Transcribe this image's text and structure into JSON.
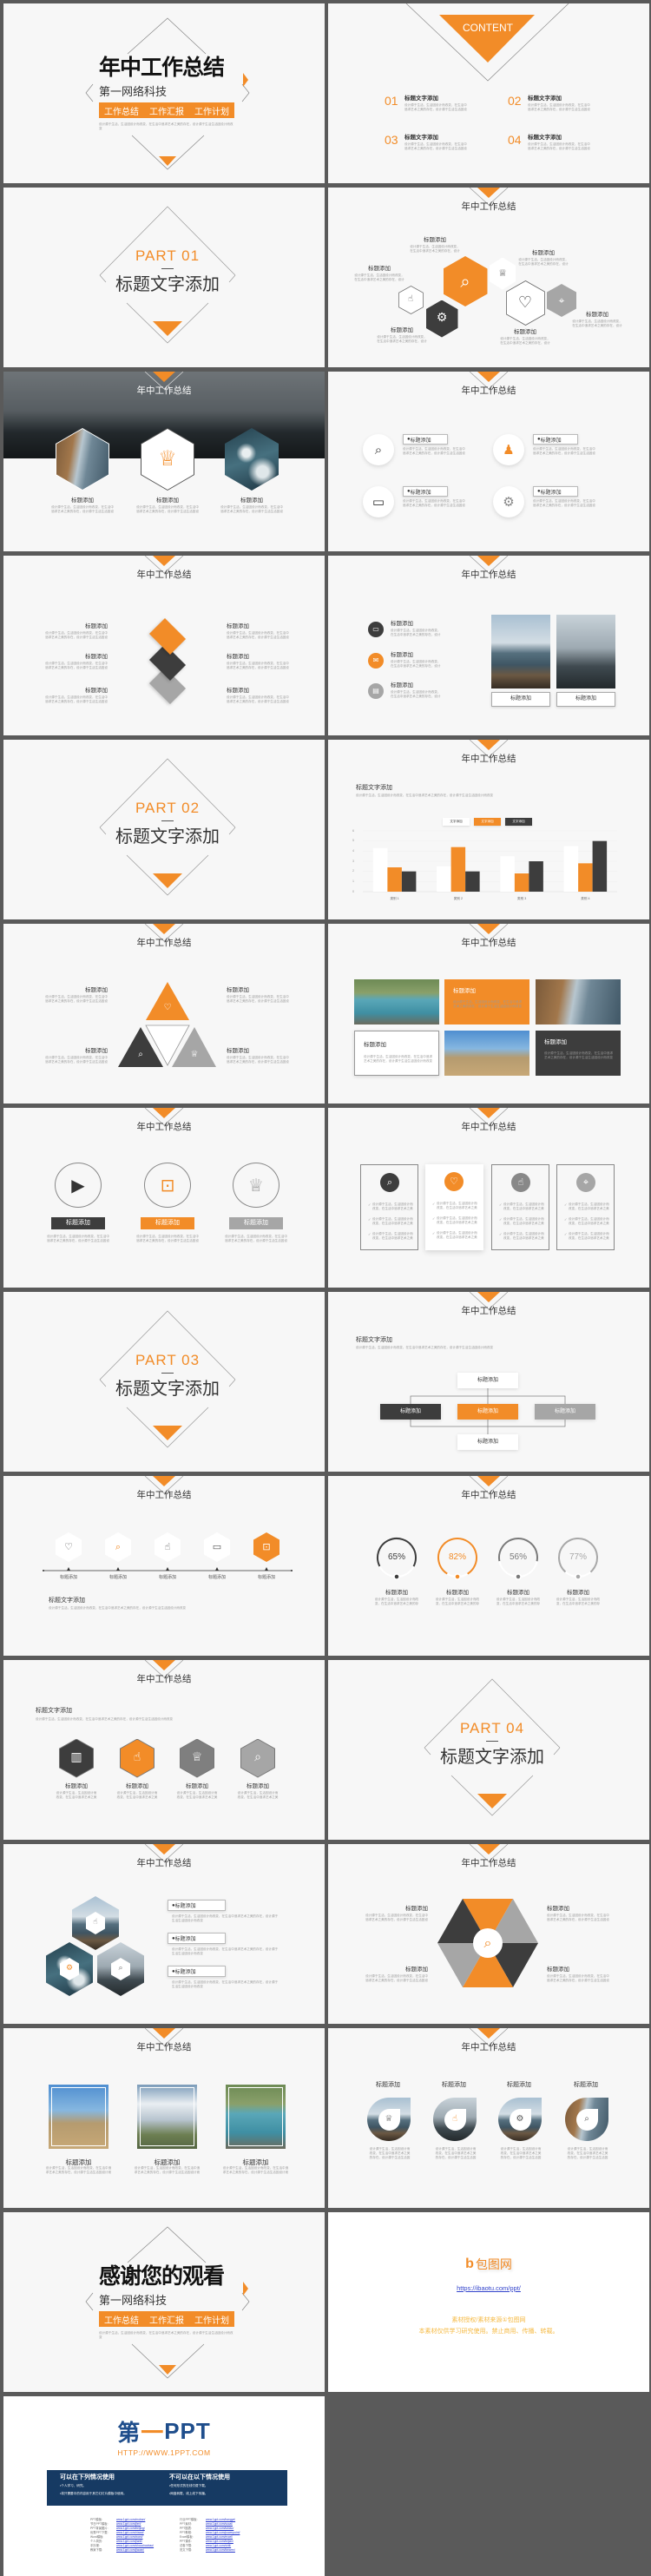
{
  "colors": {
    "accent": "#f28c28",
    "dark": "#3d3d3d",
    "gray": "#a6a6a6",
    "slide_bg": "#f7f7f7",
    "sheet_bg": "#5a5a5a",
    "navy": "#163a63"
  },
  "common": {
    "body": "设计源于生活，生活因设计而改变，在生活中追求艺术之美的存在，设计源于生活生活因设计而改变"
  },
  "slides": [
    {
      "type": "cover",
      "title": "年中工作总结",
      "subtitle": "第一网络科技",
      "tags": [
        "工作总结",
        "工作汇报",
        "工作计划"
      ]
    },
    {
      "type": "contents",
      "heading": "CONTENT",
      "items": [
        {
          "num": "01",
          "title": "标题文字添加"
        },
        {
          "num": "02",
          "title": "标题文字添加"
        },
        {
          "num": "03",
          "title": "标题文字添加"
        },
        {
          "num": "04",
          "title": "标题文字添加"
        }
      ]
    },
    {
      "type": "part",
      "part": "PART 01",
      "title": "标题文字添加"
    },
    {
      "type": "hexcluster",
      "title": "年中工作总结",
      "labels": [
        "标题添加",
        "标题添加",
        "标题添加",
        "标题添加",
        "标题添加",
        "标题添加"
      ],
      "icons": [
        "search",
        "trophy",
        "thumbs",
        "gear",
        "heart",
        "location"
      ]
    },
    {
      "type": "photohex",
      "title": "年中工作总结",
      "labels": [
        "标题添加",
        "标题添加",
        "标题添加"
      ],
      "icons": [
        "trophy"
      ]
    },
    {
      "type": "circles4",
      "title": "年中工作总结",
      "labels": [
        "标题添加",
        "标题添加",
        "标题添加",
        "标题添加"
      ],
      "icons": [
        "search",
        "user",
        "monitor",
        "gear"
      ]
    },
    {
      "type": "diamonds",
      "title": "年中工作总结",
      "labels": [
        "标题添加",
        "标题添加",
        "标题添加",
        "标题添加",
        "标题添加",
        "标题添加"
      ]
    },
    {
      "type": "listphotos",
      "title": "年中工作总结",
      "labels": [
        "标题添加",
        "标题添加",
        "标题添加"
      ],
      "captions": [
        "标题添加",
        "标题添加"
      ],
      "icons": [
        "monitor",
        "mail",
        "doc"
      ]
    },
    {
      "type": "part",
      "part": "PART 02",
      "title": "标题文字添加"
    },
    {
      "type": "chart",
      "title": "年中工作总结",
      "heading": "标题文字添加"
    },
    {
      "type": "triangles",
      "title": "年中工作总结",
      "labels": [
        "标题添加",
        "标题添加",
        "标题添加",
        "标题添加"
      ],
      "icons": [
        "heart",
        "search",
        "trophy"
      ]
    },
    {
      "type": "grid",
      "title": "年中工作总结",
      "labels": [
        "标题添加",
        "标题添加",
        "标题添加"
      ]
    },
    {
      "type": "circlebars",
      "title": "年中工作总结",
      "labels": [
        "标题添加",
        "标题添加",
        "标题添加"
      ],
      "icons": [
        "play",
        "lock",
        "trophy"
      ]
    },
    {
      "type": "cards",
      "title": "年中工作总结",
      "icons": [
        "search",
        "heart",
        "thumbs",
        "location"
      ]
    },
    {
      "type": "part",
      "part": "PART 03",
      "title": "标题文字添加"
    },
    {
      "type": "org",
      "title": "年中工作总结",
      "heading": "标题文字添加",
      "boxes": [
        "标题添加",
        "标题添加",
        "标题添加",
        "标题添加",
        "标题添加"
      ]
    },
    {
      "type": "timeline",
      "title": "年中工作总结",
      "heading": "标题文字添加",
      "labels": [
        "标题添加",
        "标题添加",
        "标题添加",
        "标题添加",
        "标题添加"
      ],
      "icons": [
        "heart",
        "search",
        "thumbs",
        "monitor",
        "lock"
      ]
    },
    {
      "type": "rings",
      "title": "年中工作总结",
      "values": [
        65,
        82,
        56,
        77
      ],
      "value_labels": [
        "65%",
        "82%",
        "56%",
        "77%"
      ],
      "labels": [
        "标题添加",
        "标题添加",
        "标题添加",
        "标题添加"
      ]
    },
    {
      "type": "hex4",
      "title": "年中工作总结",
      "heading": "标题文字添加",
      "labels": [
        "标题添加",
        "标题添加",
        "标题添加",
        "标题添加"
      ],
      "icons": [
        "chart",
        "thumbs",
        "trophy",
        "search"
      ]
    },
    {
      "type": "part",
      "part": "PART 04",
      "title": "标题文字添加"
    },
    {
      "type": "photohex3",
      "title": "年中工作总结",
      "labels": [
        "标题添加",
        "标题添加",
        "标题添加"
      ],
      "icons": [
        "thumbs",
        "gear",
        "search"
      ]
    },
    {
      "type": "hextri",
      "title": "年中工作总结",
      "labels": [
        "标题添加",
        "标题添加",
        "标题添加",
        "标题添加"
      ],
      "icons": [
        "search"
      ]
    },
    {
      "type": "photos3",
      "title": "年中工作总结",
      "labels": [
        "标题添加",
        "标题添加",
        "标题添加"
      ]
    },
    {
      "type": "droplets",
      "title": "年中工作总结",
      "labels": [
        "标题添加",
        "标题添加",
        "标题添加",
        "标题添加"
      ],
      "icons": [
        "trophy",
        "thumbs",
        "gear",
        "search"
      ]
    },
    {
      "type": "cover",
      "title": "感谢您的观看",
      "subtitle": "第一网络科技",
      "tags": [
        "工作总结",
        "工作汇报",
        "工作计划"
      ]
    },
    {
      "type": "baotu",
      "logo": "包图网",
      "url": "https://ibaotu.com/ppt/",
      "line1": "素材授权/素材来源①包图网",
      "line2": "本素材仅供学习研究使用。禁止商用、传播、转载。"
    },
    {
      "type": "oneppt",
      "logo_a": "第",
      "logo_b": "一",
      "logo_c": "PPT",
      "url": "HTTP://WWW.1PPT.COM",
      "can_title": "可以在下列情况使用",
      "can_items": [
        "•个人学习、研究。",
        "•将只需要中的内容用于其它幻灯片模板中使用。"
      ],
      "cannot_title": "不可以在以下情况使用",
      "cannot_items": [
        "•任何形式的在线付费下载。",
        "•网盘转载、线上线下传播。"
      ],
      "links_left": [
        [
          "PPT模板:",
          "www.1ppt.com/moban/"
        ],
        [
          "节日PPT模板:",
          "www.1ppt.com/jieri/"
        ],
        [
          "PPT背景图片:",
          "www.1ppt.com/beijing/"
        ],
        [
          "优秀PPT下载:",
          "www.1ppt.com/xiazai/"
        ],
        [
          "Word模板:",
          "www.1ppt.com/word/"
        ],
        [
          "个人简历:",
          "www.1ppt.com/jianli/"
        ],
        [
          "手抄报:",
          "www.1ppt.com/shouchaobao/"
        ],
        [
          "教案下载:",
          "www.1ppt.com/jiaoan/"
        ]
      ],
      "links_right": [
        [
          "行业PPT模板:",
          "www.1ppt.com/hangye/"
        ],
        [
          "PPT素材:",
          "www.1ppt.com/sucai/"
        ],
        [
          "PPT图表:",
          "www.1ppt.com/tubiao/"
        ],
        [
          "PPT教程:",
          "www.1ppt.com/powerpoint/"
        ],
        [
          "Excel模板:",
          "www.1ppt.com/excel/"
        ],
        [
          "PPT课件:",
          "www.1ppt.com/kejian/"
        ],
        [
          "试卷下载:",
          "www.1ppt.com/shiti/"
        ],
        [
          "范文下载:",
          "www.1ppt.com/fanwen/"
        ]
      ]
    }
  ],
  "chart_data": {
    "type": "bar",
    "categories": [
      "类别 1",
      "类别 2",
      "类别 3",
      "类别 4"
    ],
    "series": [
      {
        "name": "文字添加",
        "color": "#ffffff",
        "values": [
          4.3,
          2.5,
          3.5,
          4.5
        ]
      },
      {
        "name": "文字添加",
        "color": "#f28c28",
        "values": [
          2.4,
          4.4,
          1.8,
          2.8
        ]
      },
      {
        "name": "文字添加",
        "color": "#3d3d3d",
        "values": [
          2,
          2,
          3,
          5
        ]
      }
    ],
    "yticks": [
      "0",
      "1",
      "2",
      "3",
      "4",
      "5",
      "6"
    ],
    "ylim": [
      0,
      6
    ],
    "legend": "top",
    "grid": true
  }
}
